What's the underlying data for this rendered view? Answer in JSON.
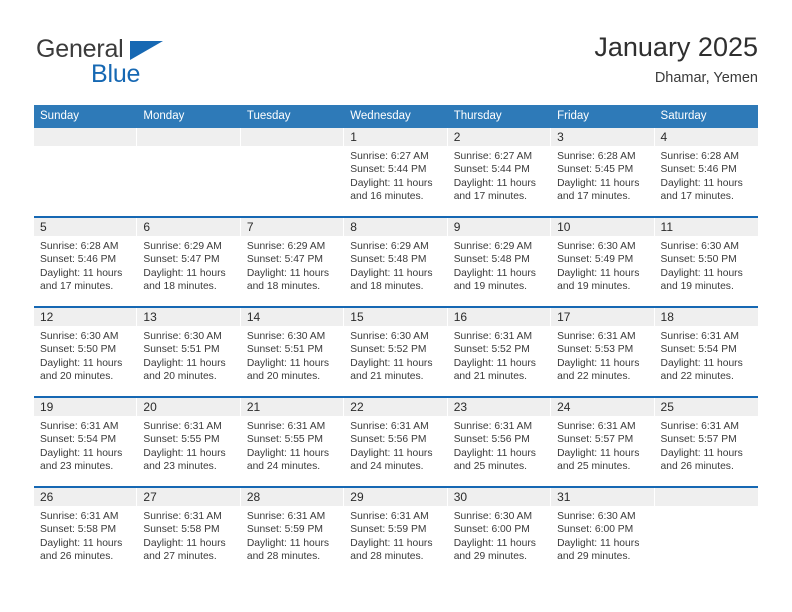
{
  "brand": {
    "name_part1": "General",
    "name_part2": "Blue",
    "accent_color": "#1668b3",
    "triangle_icon": "logo-triangle-icon"
  },
  "header": {
    "title": "January 2025",
    "subtitle": "Dhamar, Yemen"
  },
  "calendar": {
    "header_bg": "#2e7ab8",
    "row_divider_color": "#1668b3",
    "daynum_band_color": "#efefef",
    "weekday_headers": [
      "Sunday",
      "Monday",
      "Tuesday",
      "Wednesday",
      "Thursday",
      "Friday",
      "Saturday"
    ],
    "weeks": [
      [
        {
          "day": "",
          "sunrise": "",
          "sunset": "",
          "daylight_line1": "",
          "daylight_line2": ""
        },
        {
          "day": "",
          "sunrise": "",
          "sunset": "",
          "daylight_line1": "",
          "daylight_line2": ""
        },
        {
          "day": "",
          "sunrise": "",
          "sunset": "",
          "daylight_line1": "",
          "daylight_line2": ""
        },
        {
          "day": "1",
          "sunrise": "Sunrise: 6:27 AM",
          "sunset": "Sunset: 5:44 PM",
          "daylight_line1": "Daylight: 11 hours",
          "daylight_line2": "and 16 minutes."
        },
        {
          "day": "2",
          "sunrise": "Sunrise: 6:27 AM",
          "sunset": "Sunset: 5:44 PM",
          "daylight_line1": "Daylight: 11 hours",
          "daylight_line2": "and 17 minutes."
        },
        {
          "day": "3",
          "sunrise": "Sunrise: 6:28 AM",
          "sunset": "Sunset: 5:45 PM",
          "daylight_line1": "Daylight: 11 hours",
          "daylight_line2": "and 17 minutes."
        },
        {
          "day": "4",
          "sunrise": "Sunrise: 6:28 AM",
          "sunset": "Sunset: 5:46 PM",
          "daylight_line1": "Daylight: 11 hours",
          "daylight_line2": "and 17 minutes."
        }
      ],
      [
        {
          "day": "5",
          "sunrise": "Sunrise: 6:28 AM",
          "sunset": "Sunset: 5:46 PM",
          "daylight_line1": "Daylight: 11 hours",
          "daylight_line2": "and 17 minutes."
        },
        {
          "day": "6",
          "sunrise": "Sunrise: 6:29 AM",
          "sunset": "Sunset: 5:47 PM",
          "daylight_line1": "Daylight: 11 hours",
          "daylight_line2": "and 18 minutes."
        },
        {
          "day": "7",
          "sunrise": "Sunrise: 6:29 AM",
          "sunset": "Sunset: 5:47 PM",
          "daylight_line1": "Daylight: 11 hours",
          "daylight_line2": "and 18 minutes."
        },
        {
          "day": "8",
          "sunrise": "Sunrise: 6:29 AM",
          "sunset": "Sunset: 5:48 PM",
          "daylight_line1": "Daylight: 11 hours",
          "daylight_line2": "and 18 minutes."
        },
        {
          "day": "9",
          "sunrise": "Sunrise: 6:29 AM",
          "sunset": "Sunset: 5:48 PM",
          "daylight_line1": "Daylight: 11 hours",
          "daylight_line2": "and 19 minutes."
        },
        {
          "day": "10",
          "sunrise": "Sunrise: 6:30 AM",
          "sunset": "Sunset: 5:49 PM",
          "daylight_line1": "Daylight: 11 hours",
          "daylight_line2": "and 19 minutes."
        },
        {
          "day": "11",
          "sunrise": "Sunrise: 6:30 AM",
          "sunset": "Sunset: 5:50 PM",
          "daylight_line1": "Daylight: 11 hours",
          "daylight_line2": "and 19 minutes."
        }
      ],
      [
        {
          "day": "12",
          "sunrise": "Sunrise: 6:30 AM",
          "sunset": "Sunset: 5:50 PM",
          "daylight_line1": "Daylight: 11 hours",
          "daylight_line2": "and 20 minutes."
        },
        {
          "day": "13",
          "sunrise": "Sunrise: 6:30 AM",
          "sunset": "Sunset: 5:51 PM",
          "daylight_line1": "Daylight: 11 hours",
          "daylight_line2": "and 20 minutes."
        },
        {
          "day": "14",
          "sunrise": "Sunrise: 6:30 AM",
          "sunset": "Sunset: 5:51 PM",
          "daylight_line1": "Daylight: 11 hours",
          "daylight_line2": "and 20 minutes."
        },
        {
          "day": "15",
          "sunrise": "Sunrise: 6:30 AM",
          "sunset": "Sunset: 5:52 PM",
          "daylight_line1": "Daylight: 11 hours",
          "daylight_line2": "and 21 minutes."
        },
        {
          "day": "16",
          "sunrise": "Sunrise: 6:31 AM",
          "sunset": "Sunset: 5:52 PM",
          "daylight_line1": "Daylight: 11 hours",
          "daylight_line2": "and 21 minutes."
        },
        {
          "day": "17",
          "sunrise": "Sunrise: 6:31 AM",
          "sunset": "Sunset: 5:53 PM",
          "daylight_line1": "Daylight: 11 hours",
          "daylight_line2": "and 22 minutes."
        },
        {
          "day": "18",
          "sunrise": "Sunrise: 6:31 AM",
          "sunset": "Sunset: 5:54 PM",
          "daylight_line1": "Daylight: 11 hours",
          "daylight_line2": "and 22 minutes."
        }
      ],
      [
        {
          "day": "19",
          "sunrise": "Sunrise: 6:31 AM",
          "sunset": "Sunset: 5:54 PM",
          "daylight_line1": "Daylight: 11 hours",
          "daylight_line2": "and 23 minutes."
        },
        {
          "day": "20",
          "sunrise": "Sunrise: 6:31 AM",
          "sunset": "Sunset: 5:55 PM",
          "daylight_line1": "Daylight: 11 hours",
          "daylight_line2": "and 23 minutes."
        },
        {
          "day": "21",
          "sunrise": "Sunrise: 6:31 AM",
          "sunset": "Sunset: 5:55 PM",
          "daylight_line1": "Daylight: 11 hours",
          "daylight_line2": "and 24 minutes."
        },
        {
          "day": "22",
          "sunrise": "Sunrise: 6:31 AM",
          "sunset": "Sunset: 5:56 PM",
          "daylight_line1": "Daylight: 11 hours",
          "daylight_line2": "and 24 minutes."
        },
        {
          "day": "23",
          "sunrise": "Sunrise: 6:31 AM",
          "sunset": "Sunset: 5:56 PM",
          "daylight_line1": "Daylight: 11 hours",
          "daylight_line2": "and 25 minutes."
        },
        {
          "day": "24",
          "sunrise": "Sunrise: 6:31 AM",
          "sunset": "Sunset: 5:57 PM",
          "daylight_line1": "Daylight: 11 hours",
          "daylight_line2": "and 25 minutes."
        },
        {
          "day": "25",
          "sunrise": "Sunrise: 6:31 AM",
          "sunset": "Sunset: 5:57 PM",
          "daylight_line1": "Daylight: 11 hours",
          "daylight_line2": "and 26 minutes."
        }
      ],
      [
        {
          "day": "26",
          "sunrise": "Sunrise: 6:31 AM",
          "sunset": "Sunset: 5:58 PM",
          "daylight_line1": "Daylight: 11 hours",
          "daylight_line2": "and 26 minutes."
        },
        {
          "day": "27",
          "sunrise": "Sunrise: 6:31 AM",
          "sunset": "Sunset: 5:58 PM",
          "daylight_line1": "Daylight: 11 hours",
          "daylight_line2": "and 27 minutes."
        },
        {
          "day": "28",
          "sunrise": "Sunrise: 6:31 AM",
          "sunset": "Sunset: 5:59 PM",
          "daylight_line1": "Daylight: 11 hours",
          "daylight_line2": "and 28 minutes."
        },
        {
          "day": "29",
          "sunrise": "Sunrise: 6:31 AM",
          "sunset": "Sunset: 5:59 PM",
          "daylight_line1": "Daylight: 11 hours",
          "daylight_line2": "and 28 minutes."
        },
        {
          "day": "30",
          "sunrise": "Sunrise: 6:30 AM",
          "sunset": "Sunset: 6:00 PM",
          "daylight_line1": "Daylight: 11 hours",
          "daylight_line2": "and 29 minutes."
        },
        {
          "day": "31",
          "sunrise": "Sunrise: 6:30 AM",
          "sunset": "Sunset: 6:00 PM",
          "daylight_line1": "Daylight: 11 hours",
          "daylight_line2": "and 29 minutes."
        },
        {
          "day": "",
          "sunrise": "",
          "sunset": "",
          "daylight_line1": "",
          "daylight_line2": ""
        }
      ]
    ]
  }
}
